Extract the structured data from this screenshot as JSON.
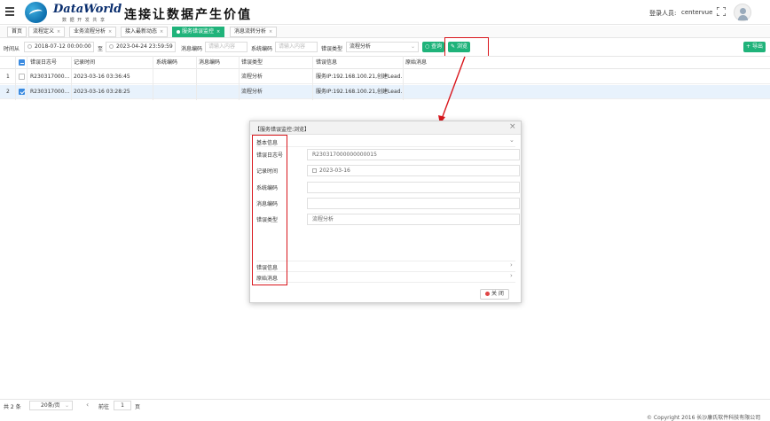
{
  "header": {
    "brand": "DataWorld",
    "brand_sub": "数 据 开 发 共 享",
    "slogan": "连接让数据产生价值",
    "login_label": "登录人员:",
    "login_user": "centervue"
  },
  "tabs": [
    {
      "label": "首页"
    },
    {
      "label": "流程定义"
    },
    {
      "label": "业务流程分析"
    },
    {
      "label": "接入最新动态"
    },
    {
      "label": "服务错误监控"
    },
    {
      "label": "消息流转分析"
    }
  ],
  "filters": {
    "time_from_label": "时间从",
    "time_from_value": "2018-07-12 00:00:00",
    "to_label": "至",
    "time_to_value": "2023-04-24 23:59:59",
    "msg_code_label": "消息编码",
    "msg_code_placeholder": "请输入内容",
    "sys_code_label": "系统编码",
    "sys_code_placeholder": "请输入内容",
    "error_type_label": "错误类型",
    "error_type_value": "流程分析",
    "query_label": "查询",
    "browse_label": "浏览",
    "export_label": "导出"
  },
  "table": {
    "columns": [
      "错误日志号",
      "记录时间",
      "系统编码",
      "消息编码",
      "错误类型",
      "错误信息",
      "原始消息"
    ],
    "rows": [
      {
        "index": "1",
        "log_no": "R230317000...",
        "time": "2023-03-16 03:36:45",
        "sys": "",
        "msg": "",
        "type": "流程分析",
        "info": "服务IP:192.168.100.21,创建Lead...",
        "raw": ""
      },
      {
        "index": "2",
        "log_no": "R230317000...",
        "time": "2023-03-16 03:28:25",
        "sys": "",
        "msg": "",
        "type": "流程分析",
        "info": "服务IP:192.168.100.21,创建Lead...",
        "raw": ""
      }
    ]
  },
  "modal": {
    "title": "【服务错误监控:浏览】",
    "section_basic": "基本信息",
    "fields": [
      {
        "label": "错误日志号",
        "value": "R230317000000000015"
      },
      {
        "label": "记录时间",
        "value": "2023-03-16"
      },
      {
        "label": "系统编码",
        "value": ""
      },
      {
        "label": "消息编码",
        "value": ""
      },
      {
        "label": "错误类型",
        "value": "流程分析"
      }
    ],
    "section_error": "错误信息",
    "section_raw": "原始消息",
    "close_label": "关 闭"
  },
  "pager": {
    "total": "共 2 条",
    "page_size": "20条/页",
    "goto_label": "前往",
    "page": "1",
    "page_unit": "页"
  },
  "copyright": "© Copyright 2016 长沙康氏软件科技有限公司"
}
